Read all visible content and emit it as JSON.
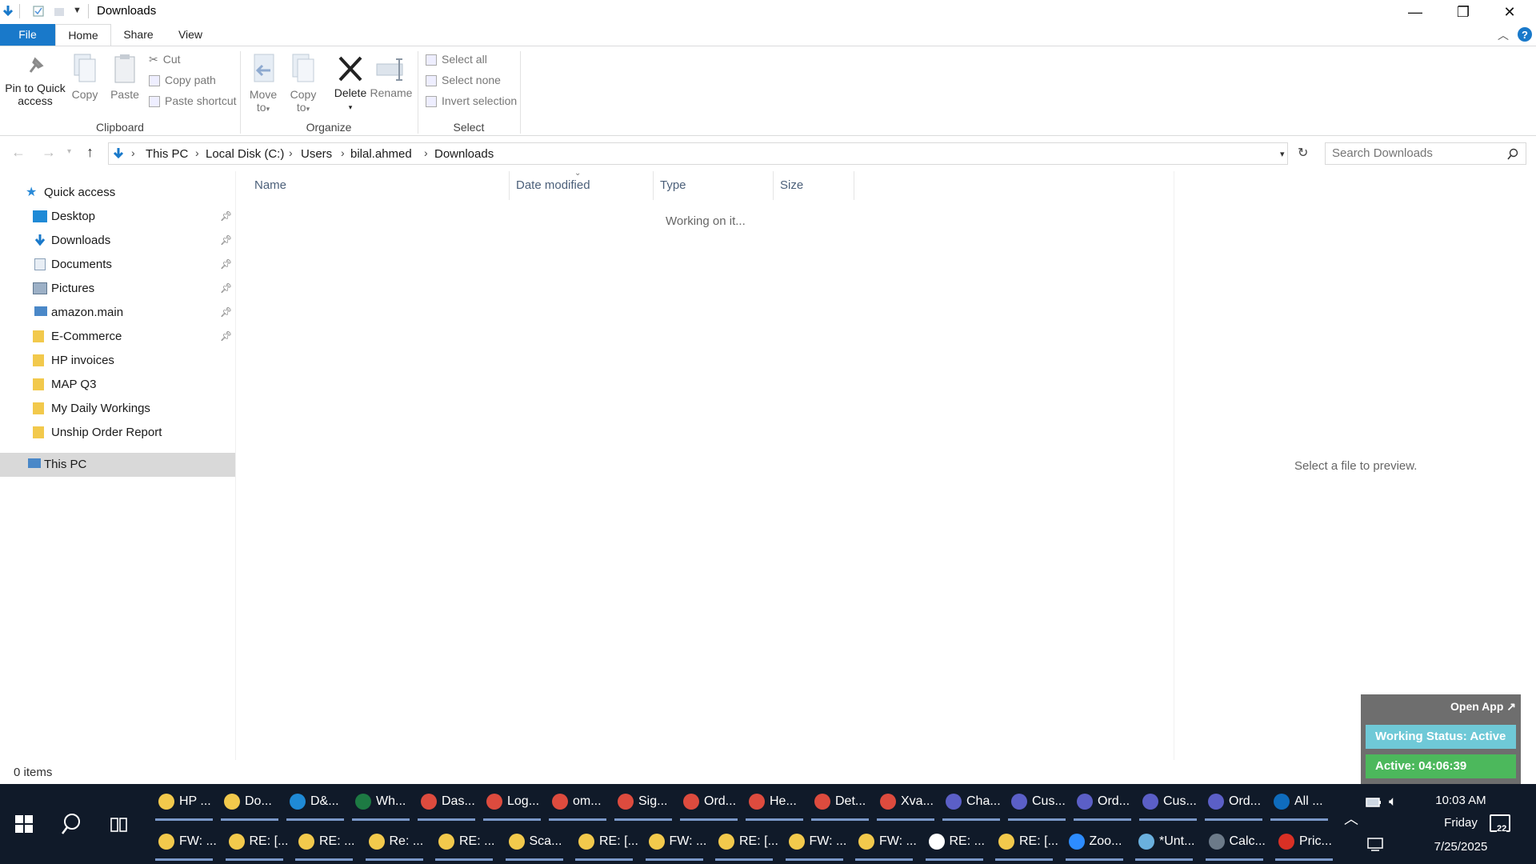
{
  "window": {
    "title": "Downloads",
    "tabs": [
      "File",
      "Home",
      "Share",
      "View"
    ]
  },
  "ribbon": {
    "clipboard": {
      "pin": "Pin to Quick access",
      "copy": "Copy",
      "paste": "Paste",
      "cut": "Cut",
      "copy_path": "Copy path",
      "paste_shortcut": "Paste shortcut",
      "label": "Clipboard"
    },
    "organize": {
      "move_to": "Move to",
      "copy_to": "Copy to",
      "delete": "Delete",
      "rename": "Rename",
      "label": "Organize"
    },
    "select": {
      "select_all": "Select all",
      "select_none": "Select none",
      "invert": "Invert selection",
      "label": "Select"
    }
  },
  "address": {
    "crumbs": [
      "This PC",
      "Local Disk (C:)",
      "Users",
      "bilal.ahmed",
      "Downloads"
    ],
    "search_placeholder": "Search Downloads"
  },
  "nav": {
    "quick_access": "Quick access",
    "items": [
      {
        "label": "Desktop",
        "pinned": true
      },
      {
        "label": "Downloads",
        "pinned": true
      },
      {
        "label": "Documents",
        "pinned": true
      },
      {
        "label": "Pictures",
        "pinned": true
      },
      {
        "label": "amazon.main",
        "pinned": true
      },
      {
        "label": "E-Commerce",
        "pinned": true
      },
      {
        "label": "HP invoices",
        "pinned": false
      },
      {
        "label": "MAP Q3",
        "pinned": false
      },
      {
        "label": "My Daily Workings",
        "pinned": false
      },
      {
        "label": "Unship Order Report",
        "pinned": false
      }
    ],
    "this_pc": "This PC"
  },
  "content": {
    "columns": [
      "Name",
      "Date modified",
      "Type",
      "Size"
    ],
    "status_message": "Working on it...",
    "preview_message": "Select a file to preview.",
    "item_count": "0 items"
  },
  "widget": {
    "open_app": "Open App ↗",
    "working_status": "Working Status: Active",
    "active_time": "Active: 04:06:39"
  },
  "taskbar": {
    "row1": [
      {
        "label": "HP ...",
        "color": "#f2c94c"
      },
      {
        "label": "Do...",
        "color": "#f2c94c"
      },
      {
        "label": "D&...",
        "color": "#1f8ad6"
      },
      {
        "label": "Wh...",
        "color": "#1d7a43"
      },
      {
        "label": "Das...",
        "color": "#dd4b3e"
      },
      {
        "label": "Log...",
        "color": "#dd4b3e"
      },
      {
        "label": "om...",
        "color": "#dd4b3e"
      },
      {
        "label": "Sig...",
        "color": "#dd4b3e"
      },
      {
        "label": "Ord...",
        "color": "#dd4b3e"
      },
      {
        "label": "He...",
        "color": "#dd4b3e"
      },
      {
        "label": "Det...",
        "color": "#dd4b3e"
      },
      {
        "label": "Xva...",
        "color": "#dd4b3e"
      },
      {
        "label": "Cha...",
        "color": "#5b5fc7"
      },
      {
        "label": "Cus...",
        "color": "#5b5fc7"
      },
      {
        "label": "Ord...",
        "color": "#5b5fc7"
      },
      {
        "label": "Cus...",
        "color": "#5b5fc7"
      },
      {
        "label": "Ord...",
        "color": "#5b5fc7"
      },
      {
        "label": "All ...",
        "color": "#0f6cbd"
      }
    ],
    "row2": [
      {
        "label": "FW: ...",
        "color": "#f2c94c"
      },
      {
        "label": "RE: [...",
        "color": "#f2c94c"
      },
      {
        "label": "RE: ...",
        "color": "#f2c94c"
      },
      {
        "label": "Re: ...",
        "color": "#f2c94c"
      },
      {
        "label": "RE: ...",
        "color": "#f2c94c"
      },
      {
        "label": "Sca...",
        "color": "#f2c94c"
      },
      {
        "label": "RE: [...",
        "color": "#f2c94c"
      },
      {
        "label": "FW: ...",
        "color": "#f2c94c"
      },
      {
        "label": "RE: [...",
        "color": "#f2c94c"
      },
      {
        "label": "FW: ...",
        "color": "#f2c94c"
      },
      {
        "label": "FW: ...",
        "color": "#f2c94c"
      },
      {
        "label": "RE: ...",
        "color": "#ffffff"
      },
      {
        "label": "RE: [...",
        "color": "#f2c94c"
      },
      {
        "label": "Zoo...",
        "color": "#2d8cff"
      },
      {
        "label": "*Unt...",
        "color": "#6ab0de"
      },
      {
        "label": "Calc...",
        "color": "#6c7a89"
      },
      {
        "label": "Pric...",
        "color": "#d93025"
      }
    ],
    "time": "10:03 AM",
    "day": "Friday",
    "date": "7/25/2025",
    "notifications": "22"
  }
}
